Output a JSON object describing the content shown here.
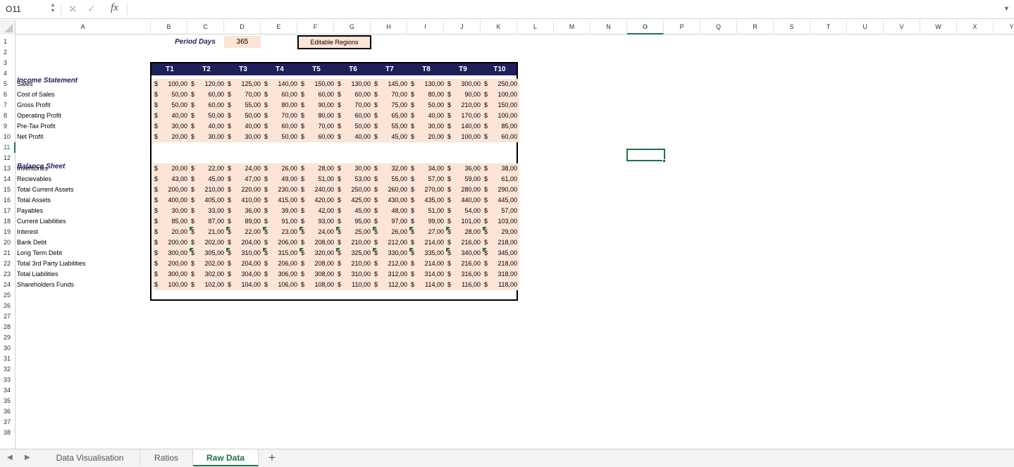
{
  "formula_bar": {
    "name_box": "O11",
    "cancel_icon": "✕",
    "enter_icon": "✓",
    "fx_label": "fx",
    "content": ""
  },
  "columns": [
    "A",
    "B",
    "C",
    "D",
    "E",
    "F",
    "G",
    "H",
    "I",
    "J",
    "K",
    "L",
    "M",
    "N",
    "O",
    "P",
    "Q",
    "R",
    "S",
    "T",
    "U",
    "V",
    "W",
    "X",
    "Y"
  ],
  "selected_column": "O",
  "selected_row": 11,
  "row_count": 38,
  "header_cells": {
    "period_days_label": "Period Days",
    "period_days_value": "365",
    "editable_regions_label": "Editable Regions"
  },
  "table": {
    "periods": [
      "T1",
      "T2",
      "T3",
      "T4",
      "T5",
      "T6",
      "T7",
      "T8",
      "T9",
      "T10"
    ],
    "currency_symbol": "$",
    "income_statement": {
      "title": "Income Statement",
      "rows": [
        {
          "label": "Sales",
          "values": [
            "100,00",
            "120,00",
            "125,00",
            "140,00",
            "150,00",
            "130,00",
            "145,00",
            "130,00",
            "300,00",
            "250,00"
          ]
        },
        {
          "label": "Cost of Sales",
          "values": [
            "50,00",
            "60,00",
            "70,00",
            "60,00",
            "60,00",
            "60,00",
            "70,00",
            "80,00",
            "90,00",
            "100,00"
          ]
        },
        {
          "label": "Gross Profit",
          "values": [
            "50,00",
            "60,00",
            "55,00",
            "80,00",
            "90,00",
            "70,00",
            "75,00",
            "50,00",
            "210,00",
            "150,00"
          ]
        },
        {
          "label": "Operating Profit",
          "values": [
            "40,00",
            "50,00",
            "50,00",
            "70,00",
            "80,00",
            "60,00",
            "65,00",
            "40,00",
            "170,00",
            "100,00"
          ]
        },
        {
          "label": "Pre-Tax Profit",
          "values": [
            "30,00",
            "40,00",
            "40,00",
            "60,00",
            "70,00",
            "50,00",
            "55,00",
            "30,00",
            "140,00",
            "85,00"
          ]
        },
        {
          "label": "Net Profit",
          "values": [
            "20,00",
            "30,00",
            "30,00",
            "50,00",
            "60,00",
            "40,00",
            "45,00",
            "20,00",
            "100,00",
            "60,00"
          ]
        }
      ]
    },
    "balance_sheet": {
      "title": "Balance Sheet",
      "rows": [
        {
          "label": "Inventories",
          "values": [
            "20,00",
            "22,00",
            "24,00",
            "26,00",
            "28,00",
            "30,00",
            "32,00",
            "34,00",
            "36,00",
            "38,00"
          ]
        },
        {
          "label": "Recievables",
          "values": [
            "43,00",
            "45,00",
            "47,00",
            "49,00",
            "51,00",
            "53,00",
            "55,00",
            "57,00",
            "59,00",
            "61,00"
          ]
        },
        {
          "label": "Total Current Assets",
          "values": [
            "200,00",
            "210,00",
            "220,00",
            "230,00",
            "240,00",
            "250,00",
            "260,00",
            "270,00",
            "280,00",
            "290,00"
          ]
        },
        {
          "label": "Total Assets",
          "values": [
            "400,00",
            "405,00",
            "410,00",
            "415,00",
            "420,00",
            "425,00",
            "430,00",
            "435,00",
            "440,00",
            "445,00"
          ]
        },
        {
          "label": "Payables",
          "values": [
            "30,00",
            "33,00",
            "36,00",
            "39,00",
            "42,00",
            "45,00",
            "48,00",
            "51,00",
            "54,00",
            "57,00"
          ]
        },
        {
          "label": "Current Liabilities",
          "values": [
            "85,00",
            "87,00",
            "89,00",
            "91,00",
            "93,00",
            "95,00",
            "97,00",
            "99,00",
            "101,00",
            "103,00"
          ]
        },
        {
          "label": "Interest",
          "values": [
            "20,00",
            "21,00",
            "22,00",
            "23,00",
            "24,00",
            "25,00",
            "26,00",
            "27,00",
            "28,00",
            "29,00"
          ],
          "flagged_from": 1
        },
        {
          "label": "Bank Debt",
          "values": [
            "200,00",
            "202,00",
            "204,00",
            "206,00",
            "208,00",
            "210,00",
            "212,00",
            "214,00",
            "216,00",
            "218,00"
          ]
        },
        {
          "label": "Long Term Debt",
          "values": [
            "300,00",
            "305,00",
            "310,00",
            "315,00",
            "320,00",
            "325,00",
            "330,00",
            "335,00",
            "340,00",
            "345,00"
          ],
          "flagged_from": 1
        },
        {
          "label": "Total 3rd Party Liabilities",
          "values": [
            "200,00",
            "202,00",
            "204,00",
            "206,00",
            "208,00",
            "210,00",
            "212,00",
            "214,00",
            "216,00",
            "218,00"
          ]
        },
        {
          "label": "Total Liabilities",
          "values": [
            "300,00",
            "302,00",
            "304,00",
            "306,00",
            "308,00",
            "310,00",
            "312,00",
            "314,00",
            "316,00",
            "318,00"
          ]
        },
        {
          "label": "Shareholders Funds",
          "values": [
            "100,00",
            "102,00",
            "104,00",
            "106,00",
            "108,00",
            "110,00",
            "112,00",
            "114,00",
            "116,00",
            "118,00"
          ]
        }
      ]
    }
  },
  "sheet_tabs": {
    "tabs": [
      "Data Visualisation",
      "Ratios",
      "Raw Data"
    ],
    "active": "Raw Data",
    "add_label": "+",
    "prev_icon": "◀",
    "next_icon": "▶"
  },
  "colors": {
    "accent": "#217346",
    "header_fill": "#1f1f5c",
    "input_fill": "#fce4d6"
  }
}
